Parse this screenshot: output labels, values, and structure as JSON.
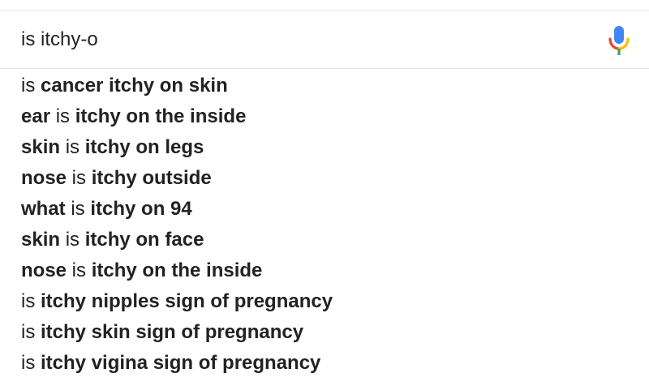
{
  "search": {
    "query": "is itchy-o",
    "mic_icon": "microphone-icon",
    "mic_colors": {
      "blue": "#4285f4",
      "red": "#ea4335",
      "yellow": "#fbbc05",
      "green": "#34a853"
    }
  },
  "suggestions": [
    {
      "parts": [
        {
          "text": "is ",
          "bold": false
        },
        {
          "text": "cancer itchy on skin",
          "bold": true
        }
      ]
    },
    {
      "parts": [
        {
          "text": "ear",
          "bold": true
        },
        {
          "text": " is ",
          "bold": false
        },
        {
          "text": "itchy on the inside",
          "bold": true
        }
      ]
    },
    {
      "parts": [
        {
          "text": "skin",
          "bold": true
        },
        {
          "text": " is ",
          "bold": false
        },
        {
          "text": "itchy on legs",
          "bold": true
        }
      ]
    },
    {
      "parts": [
        {
          "text": "nose",
          "bold": true
        },
        {
          "text": " is ",
          "bold": false
        },
        {
          "text": "itchy outside",
          "bold": true
        }
      ]
    },
    {
      "parts": [
        {
          "text": "what",
          "bold": true
        },
        {
          "text": " is ",
          "bold": false
        },
        {
          "text": "itchy on 94",
          "bold": true
        }
      ]
    },
    {
      "parts": [
        {
          "text": "skin",
          "bold": true
        },
        {
          "text": " is ",
          "bold": false
        },
        {
          "text": "itchy on face",
          "bold": true
        }
      ]
    },
    {
      "parts": [
        {
          "text": "nose",
          "bold": true
        },
        {
          "text": " is ",
          "bold": false
        },
        {
          "text": "itchy on the inside",
          "bold": true
        }
      ]
    },
    {
      "parts": [
        {
          "text": "is ",
          "bold": false
        },
        {
          "text": "itchy nipples sign of pregnancy",
          "bold": true
        }
      ]
    },
    {
      "parts": [
        {
          "text": "is ",
          "bold": false
        },
        {
          "text": "itchy skin sign of pregnancy",
          "bold": true
        }
      ]
    },
    {
      "parts": [
        {
          "text": "is ",
          "bold": false
        },
        {
          "text": "itchy vigina sign of pregnancy",
          "bold": true
        }
      ]
    }
  ]
}
